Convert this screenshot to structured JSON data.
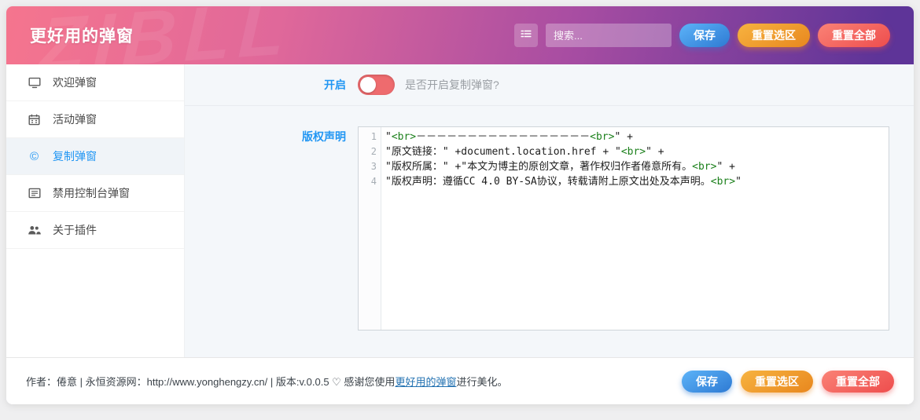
{
  "header": {
    "title": "更好用的弹窗",
    "watermark": "ZIBLL",
    "search_placeholder": "搜索...",
    "buttons": {
      "save": "保存",
      "reset_selection": "重置选区",
      "reset_all": "重置全部"
    }
  },
  "sidebar": {
    "items": [
      {
        "id": "welcome-popup",
        "label": "欢迎弹窗",
        "icon": "monitor-icon",
        "active": false
      },
      {
        "id": "activity-popup",
        "label": "活动弹窗",
        "icon": "calendar-icon",
        "active": false
      },
      {
        "id": "copy-popup",
        "label": "复制弹窗",
        "icon": "copyright-icon",
        "active": true
      },
      {
        "id": "console-popup",
        "label": "禁用控制台弹窗",
        "icon": "console-icon",
        "active": false
      },
      {
        "id": "about-plugin",
        "label": "关于插件",
        "icon": "users-icon",
        "active": false
      }
    ]
  },
  "main": {
    "toggle_row": {
      "label": "开启",
      "enabled": false,
      "description": "是否开启复制弹窗?"
    },
    "editor_row": {
      "label": "版权声明",
      "lines": [
        "\"<br>－－－－－－－－－－－－－－－－－<br>\" +",
        "\"原文链接：\" +document.location.href + \"<br>\" +",
        "\"版权所属：\" +\"本文为博主的原创文章，著作权归作者倦意所有。<br>\" +",
        "\"版权声明：遵循CC 4.0 BY-SA协议，转载请附上原文出处及本声明。<br>\""
      ]
    }
  },
  "footer": {
    "text_before_link": "作者：倦意 | 永恒资源网：http://www.yonghengzy.cn/ | 版本:v.0.0.5 ♡ 感谢您使用",
    "link": "更好用的弹窗",
    "text_after_link": "进行美化。",
    "buttons": {
      "save": "保存",
      "reset_selection": "重置选区",
      "reset_all": "重置全部"
    }
  },
  "colors": {
    "header_gradient_start": "#f5758e",
    "header_gradient_end": "#5e3498",
    "accent_blue": "#2196f3",
    "toggle_off_red": "#ee6b6e",
    "button_save_blue": "#2e7ad3",
    "button_reset_orange": "#e8871e",
    "button_resetall_red": "#ee4d4d",
    "code_tag_green": "#1c801c",
    "main_bg": "#f4f7fa"
  }
}
